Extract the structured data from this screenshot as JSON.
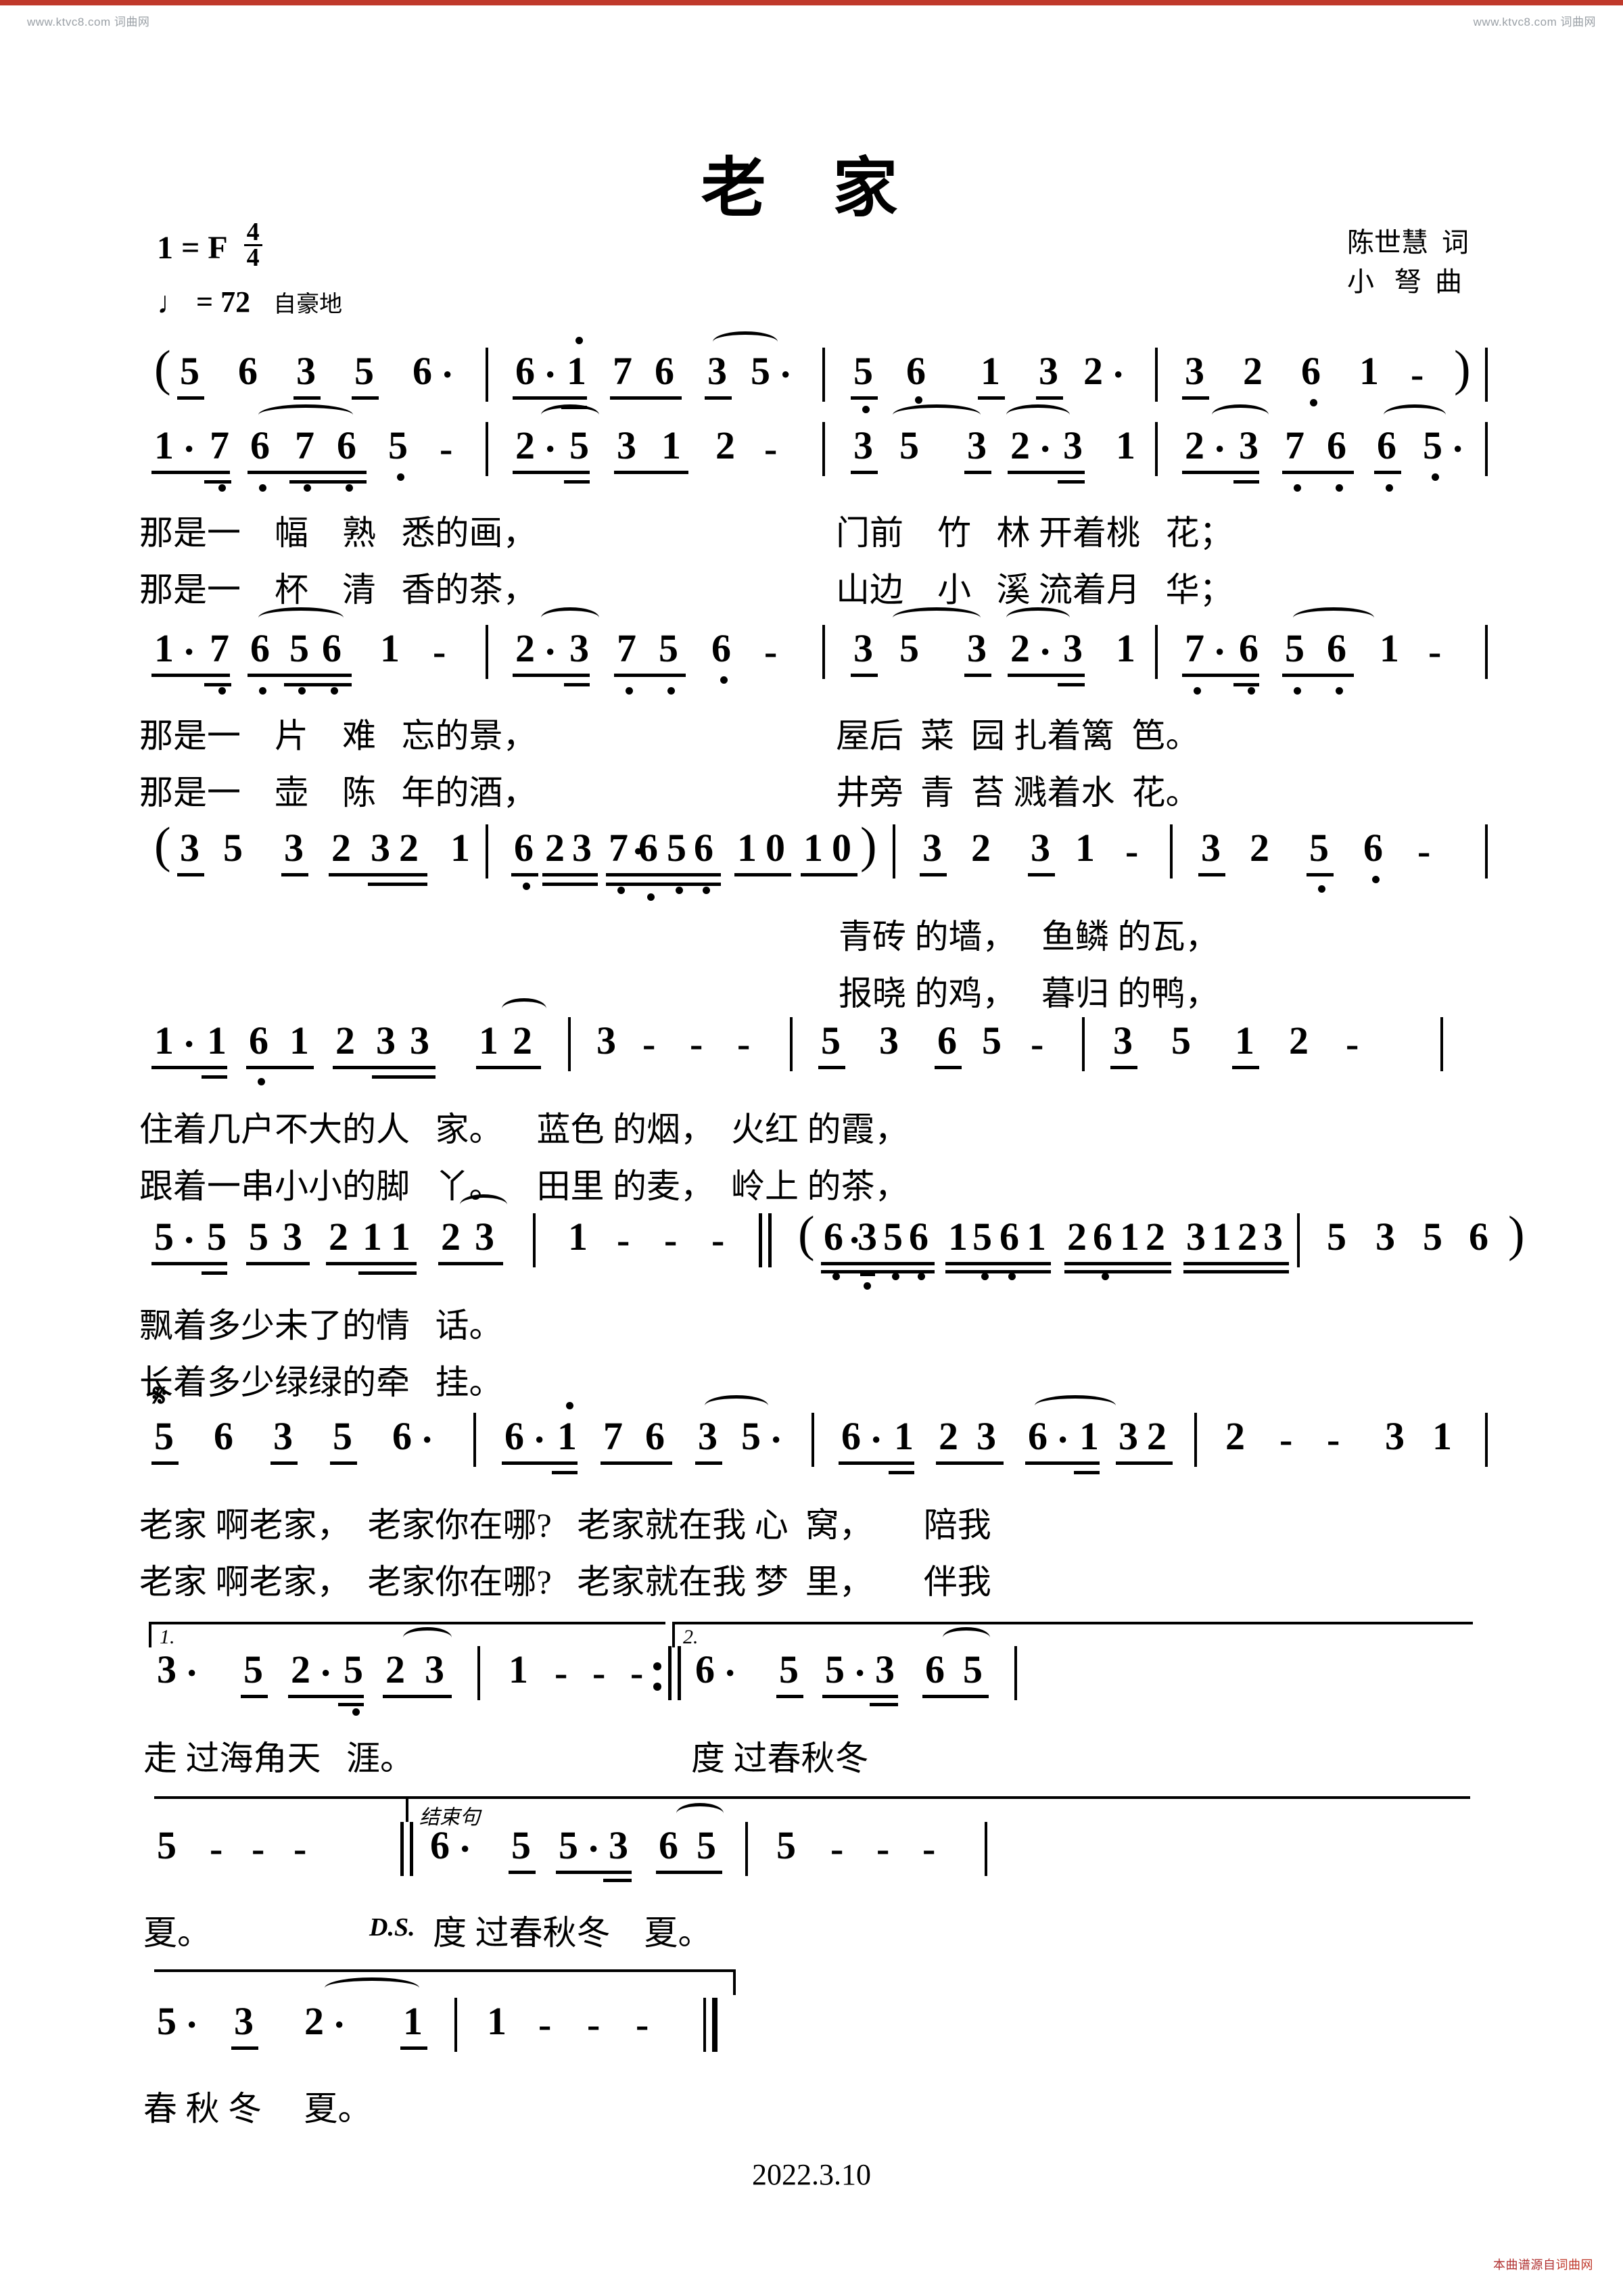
{
  "page": {
    "watermark_left": "www.ktvc8.com  词曲网",
    "watermark_right": "www.ktvc8.com  词曲网",
    "watermark_bottom": "本曲谱源自",
    "watermark_bottom_site": "词曲网",
    "date": "2022.3.10"
  },
  "header": {
    "title": "老 家",
    "key_label": "1 = F",
    "time_top": "4",
    "time_bottom": "4",
    "tempo_note": "♩",
    "tempo_eq": "= 72",
    "expression": "自豪地",
    "lyricist": "陈世慧  词",
    "composer": "小   弩  曲"
  },
  "systems": [
    {
      "id": "intro",
      "notes": "( 5 6 3 5 6·  |  6· 1 7 6 3 5·  |  5 6 1 3 2·  |  3 2 6 1 -  )",
      "lyrics": []
    },
    {
      "id": "verse-a",
      "notes": "1· 7 6 7 6 5 -  |  2· 5 3 1 2 -  |  3 5 3 2· 3 1  |  2· 3 7 6 6 5·",
      "lyrics": [
        "那是一    幅    熟   悉的画，",
        "那是一    杯    清   香的茶，",
        "门前    竹   林 开着桃   花；",
        "山边    小   溪 流着月   华；"
      ]
    },
    {
      "id": "verse-b",
      "notes": "1· 7 6 5 6 1 -  |  2· 3 7 5 6 -  |  3 5 3 2· 3 1  |  7· 6 5 6 1 -",
      "lyrics": [
        "那是一    片    难   忘的景，",
        "那是一    壶    陈   年的酒，",
        "屋后  菜  园 扎着篱  笆。",
        "井旁  青  苔 溅着水  花。"
      ]
    },
    {
      "id": "interlude-1",
      "notes": "( 3 5 3 2 32 1  |  623 7656 10 10 )  3 2 3 1 -  |  3 2 5 6· -",
      "lyrics": [
        "青砖 的墙，   鱼鳞 的瓦，",
        "报晓 的鸡，   暮归 的鸭，"
      ]
    },
    {
      "id": "verse-c",
      "notes": "1· 1 6 1 2 3 3 1 2  |  3 - - -  |  5 3 6 5 -  |  3 5 1 2 -",
      "lyrics": [
        "住着几户不大的人   家。    蓝色 的烟，  火红 的霞，",
        "跟着一串小小的脚   丫。    田里 的麦，  岭上 的茶，"
      ]
    },
    {
      "id": "verse-d",
      "notes": "5· 5 5 3 2 1 1 2 3  |  1 - - -  ‖ ( 6·356 1561 2612 3123 | 5 3 5 6 )",
      "lyrics": [
        "飘着多少未了的情   话。",
        "长着多少绿绿的牵   挂。"
      ]
    },
    {
      "id": "chorus",
      "segno": "𝄋",
      "notes": "5 6 3 5 6·  |  6· 1 7 6 3 5·  |  6· 1 2 3 6· 1 3 2  |  2 - - 3 1",
      "lyrics": [
        "老家 啊老家，  老家你在哪?   老家就在我 心  窝，      陪我",
        "老家 啊老家，  老家你在哪?   老家就在我 梦  里，      伴我"
      ]
    },
    {
      "id": "endings",
      "volta1": "1.",
      "volta2": "2.",
      "notes": "3· 5 2· 5 2 3  |  1 - - - :‖  6· 5 5·3 6 5  |",
      "lyrics": [
        "走 过海角天   涯。",
        "度 过春秋冬"
      ]
    },
    {
      "id": "coda-lead",
      "end_label": "结束句",
      "ds_mark": "D.S.",
      "notes": "5 - - -  ‖  6· 5 5·3 6 5  |  5 - - -  |",
      "lyrics": [
        "夏。",
        "度 过春秋冬    夏。"
      ]
    },
    {
      "id": "coda",
      "notes": "5· 3 2· 1  |  1 - - -  ‖",
      "lyrics": [
        "春 秋 冬     夏。"
      ]
    }
  ]
}
